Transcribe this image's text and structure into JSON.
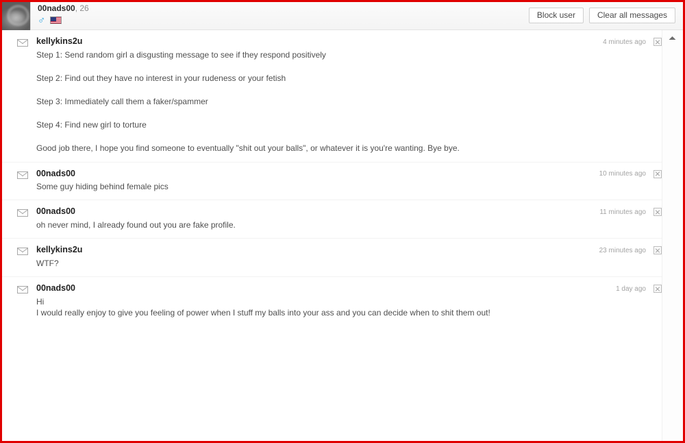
{
  "header": {
    "profile": {
      "username": "00nads00",
      "age_separator": ", ",
      "age": "26",
      "gender_icon": "male-symbol",
      "gender_glyph": "♂",
      "country_icon": "us-flag",
      "avatar_icon": "profile-avatar"
    },
    "buttons": {
      "block_user": "Block user",
      "clear_all": "Clear all messages"
    }
  },
  "scrollbar": {
    "up_arrow_icon": "scroll-up-arrow"
  },
  "messages": [
    {
      "author": "kellykins2u",
      "time": "4 minutes ago",
      "delete_icon": "delete-message-icon",
      "envelope_icon": "envelope-icon",
      "paragraphs": [
        "Step 1: Send random girl a disgusting message to see if they respond positively",
        "Step 2: Find out they have no interest in your rudeness or your fetish",
        "Step 3: Immediately call them a faker/spammer",
        "Step 4: Find new girl to torture",
        "Good job there, I hope you find someone to eventually \"shit out your balls\", or whatever it is you're wanting. Bye bye."
      ]
    },
    {
      "author": "00nads00",
      "time": "10 minutes ago",
      "delete_icon": "delete-message-icon",
      "envelope_icon": "envelope-icon",
      "paragraphs": [
        "Some guy hiding behind female pics"
      ]
    },
    {
      "author": "00nads00",
      "time": "11 minutes ago",
      "delete_icon": "delete-message-icon",
      "envelope_icon": "envelope-icon",
      "paragraphs": [
        "oh never mind, I already found out you are fake profile."
      ]
    },
    {
      "author": "kellykins2u",
      "time": "23 minutes ago",
      "delete_icon": "delete-message-icon",
      "envelope_icon": "envelope-icon",
      "paragraphs": [
        "WTF?"
      ]
    },
    {
      "author": "00nads00",
      "time": "1 day ago",
      "delete_icon": "delete-message-icon",
      "envelope_icon": "envelope-icon",
      "tight": true,
      "paragraphs": [
        "Hi",
        "I would really enjoy to give you feeling of power when I stuff my balls into your ass and you can decide when to shit them out!"
      ]
    }
  ],
  "colors": {
    "frame": "#e00000",
    "accent_gender": "#2ba3e0",
    "header_bg": "#f4f4f4",
    "text": "#4f4f4f"
  }
}
